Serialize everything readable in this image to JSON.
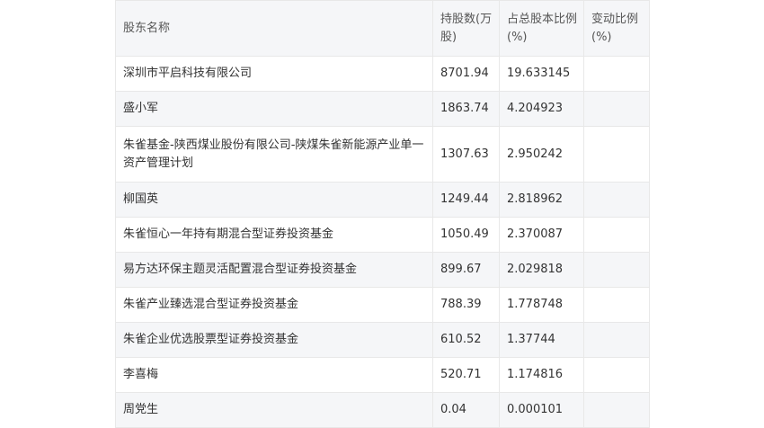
{
  "table": {
    "headers": [
      "股东名称",
      "持股数(万股)",
      "占总股本比例(%)",
      "变动比例(%)"
    ],
    "rows": [
      {
        "name": "深圳市平启科技有限公司",
        "shares": "8701.94",
        "ratio": "19.633145",
        "change": ""
      },
      {
        "name": "盛小军",
        "shares": "1863.74",
        "ratio": "4.204923",
        "change": ""
      },
      {
        "name": "朱雀基金-陕西煤业股份有限公司-陕煤朱雀新能源产业单一资产管理计划",
        "shares": "1307.63",
        "ratio": "2.950242",
        "change": ""
      },
      {
        "name": "柳国英",
        "shares": "1249.44",
        "ratio": "2.818962",
        "change": ""
      },
      {
        "name": "朱雀恒心一年持有期混合型证券投资基金",
        "shares": "1050.49",
        "ratio": "2.370087",
        "change": ""
      },
      {
        "name": "易方达环保主题灵活配置混合型证券投资基金",
        "shares": "899.67",
        "ratio": "2.029818",
        "change": ""
      },
      {
        "name": "朱雀产业臻选混合型证券投资基金",
        "shares": "788.39",
        "ratio": "1.778748",
        "change": ""
      },
      {
        "name": "朱雀企业优选股票型证券投资基金",
        "shares": "610.52",
        "ratio": "1.37744",
        "change": ""
      },
      {
        "name": "李喜梅",
        "shares": "520.71",
        "ratio": "1.174816",
        "change": ""
      },
      {
        "name": "周党生",
        "shares": "0.04",
        "ratio": "0.000101",
        "change": ""
      }
    ]
  }
}
